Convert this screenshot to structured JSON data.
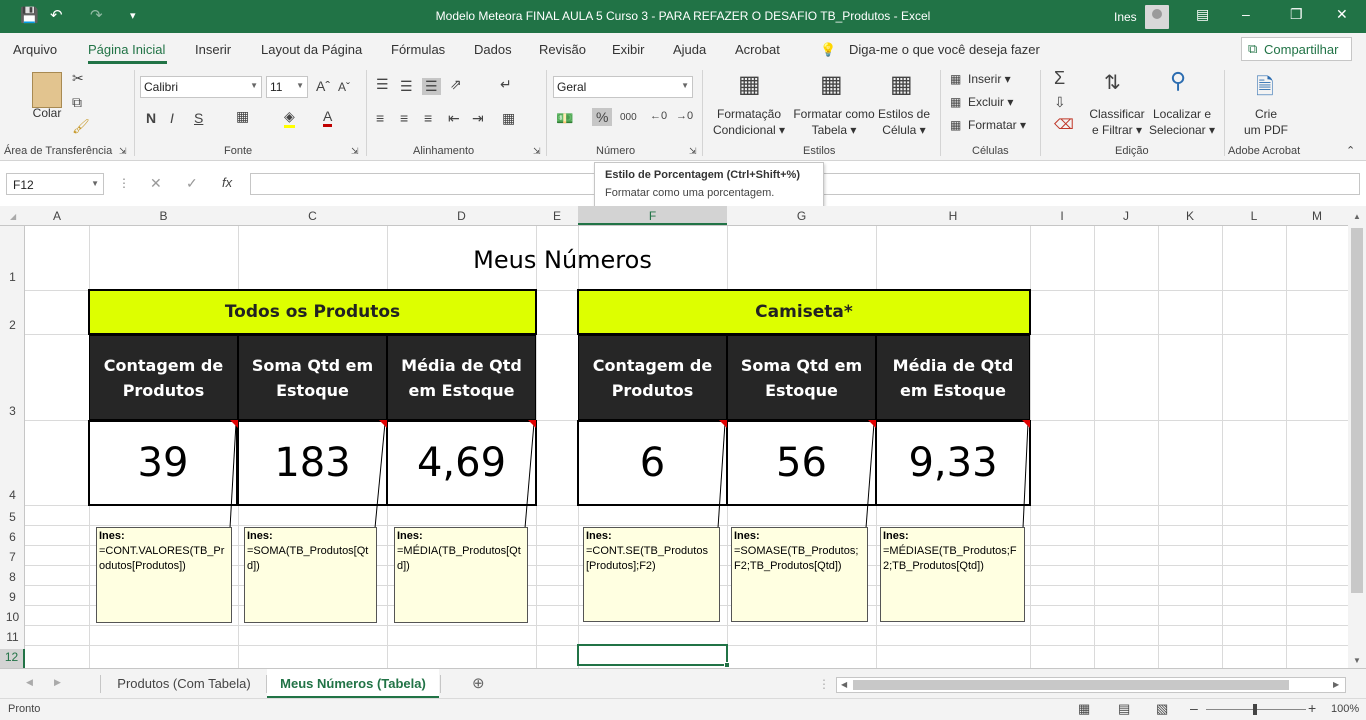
{
  "window": {
    "title": "Modelo Meteora FINAL AULA 5 Curso 3 - PARA REFAZER O DESAFIO TB_Produtos  -  Excel",
    "user": "Ines"
  },
  "menu": {
    "tabs": [
      "Arquivo",
      "Página Inicial",
      "Inserir",
      "Layout da Página",
      "Fórmulas",
      "Dados",
      "Revisão",
      "Exibir",
      "Ajuda",
      "Acrobat"
    ],
    "active": "Página Inicial",
    "search": "Diga-me o que você deseja fazer",
    "share": "Compartilhar"
  },
  "ribbon": {
    "clipboard": {
      "paste": "Colar",
      "label": "Área de Transferência"
    },
    "font": {
      "name": "Calibri",
      "size": "11",
      "bold": "N",
      "italic": "I",
      "underline": "S",
      "label": "Fonte"
    },
    "alignment": {
      "label": "Alinhamento"
    },
    "number": {
      "format": "Geral",
      "label": "Número",
      "thousands": "000"
    },
    "styles": {
      "conditional_1": "Formatação",
      "conditional_2": "Condicional",
      "table_1": "Formatar como",
      "table_2": "Tabela",
      "cell_1": "Estilos de",
      "cell_2": "Célula",
      "label": "Estilos"
    },
    "cells": {
      "insert": "Inserir",
      "delete": "Excluir",
      "format": "Formatar",
      "label": "Células"
    },
    "editing": {
      "sort_1": "Classificar",
      "sort_2": "e Filtrar",
      "find_1": "Localizar e",
      "find_2": "Selecionar",
      "label": "Edição"
    },
    "acrobat": {
      "pdf_1": "Crie",
      "pdf_2": "um PDF",
      "label": "Adobe Acrobat"
    }
  },
  "tooltip": {
    "title": "Estilo de Porcentagem (Ctrl+Shift+%)",
    "body": "Formatar como uma porcentagem."
  },
  "formula_bar": {
    "name_box": "F12",
    "content": ""
  },
  "columns": [
    "A",
    "B",
    "C",
    "D",
    "E",
    "F",
    "G",
    "H",
    "I",
    "J",
    "K",
    "L",
    "M"
  ],
  "rows": [
    "1",
    "2",
    "3",
    "4",
    "5",
    "6",
    "7",
    "8",
    "9",
    "10",
    "11",
    "12"
  ],
  "sheet": {
    "title": "Meus Números",
    "left": {
      "header": "Todos os Produtos",
      "cols": [
        "Contagem de Produtos",
        "Soma Qtd em Estoque",
        "Média de Qtd em Estoque"
      ],
      "values": [
        "39",
        "183",
        "4,69"
      ]
    },
    "right": {
      "header": "Camiseta*",
      "cols": [
        "Contagem de Produtos",
        "Soma Qtd em Estoque",
        "Média de Qtd em Estoque"
      ],
      "values": [
        "6",
        "56",
        "9,33"
      ]
    },
    "notes": [
      {
        "author": "Ines:",
        "text": "=CONT.VALORES(TB_Produtos[Produtos])"
      },
      {
        "author": "Ines:",
        "text": "=SOMA(TB_Produtos[Qtd])"
      },
      {
        "author": "Ines:",
        "text": "=MÉDIA(TB_Produtos[Qtd])"
      },
      {
        "author": "Ines:",
        "text": "=CONT.SE(TB_Produtos[Produtos];F2)"
      },
      {
        "author": "Ines:",
        "text": "=SOMASE(TB_Produtos;F2;TB_Produtos[Qtd])"
      },
      {
        "author": "Ines:",
        "text": "=MÉDIASE(TB_Produtos;F2;TB_Produtos[Qtd])"
      }
    ]
  },
  "sheet_tabs": [
    "Produtos (Com Tabela)",
    "Meus Números (Tabela)"
  ],
  "active_sheet": "Meus Números (Tabela)",
  "status": {
    "ready": "Pronto",
    "zoom": "100%"
  },
  "colors": {
    "accent": "#217346",
    "header_fill": "#ddff00",
    "dark_fill": "#262626",
    "note_fill": "#ffffe1"
  }
}
